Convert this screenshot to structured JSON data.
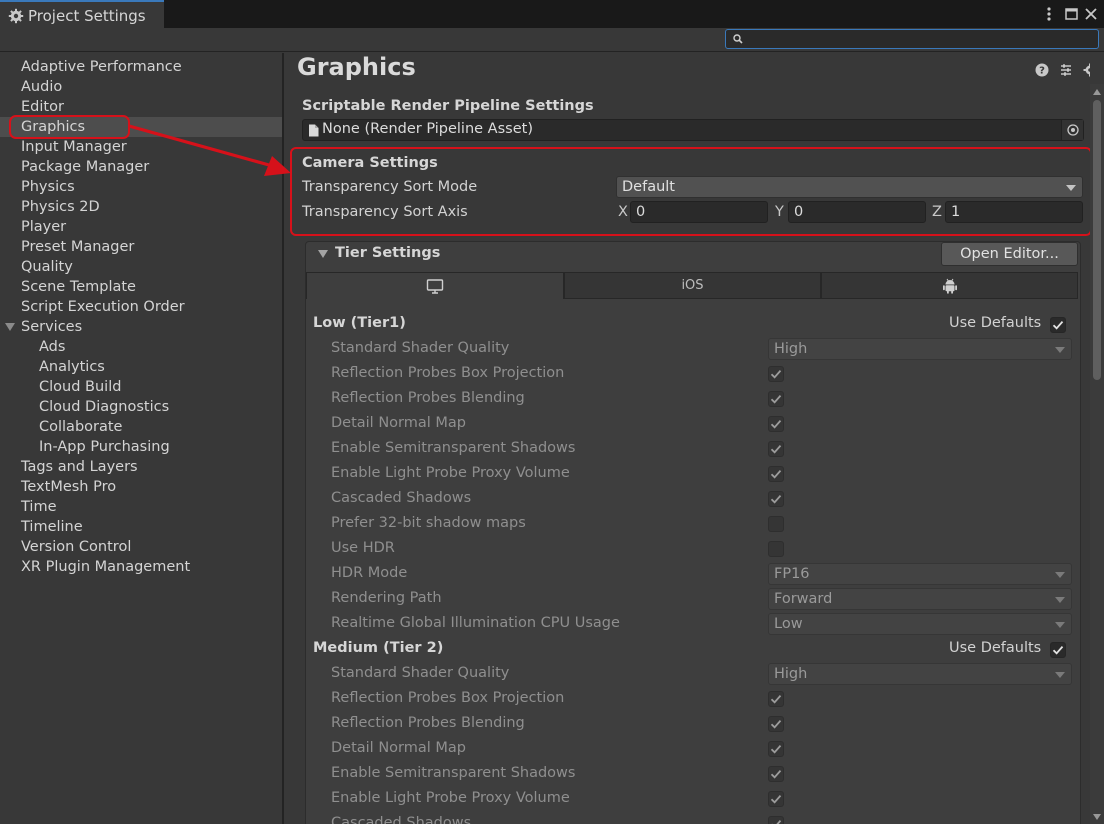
{
  "window": {
    "title": "Project Settings"
  },
  "search": {
    "placeholder": "",
    "value": ""
  },
  "sidebar": {
    "items": [
      {
        "label": "Adaptive Performance",
        "indent": 0
      },
      {
        "label": "Audio",
        "indent": 0
      },
      {
        "label": "Editor",
        "indent": 0
      },
      {
        "label": "Graphics",
        "indent": 0,
        "selected": true
      },
      {
        "label": "Input Manager",
        "indent": 0
      },
      {
        "label": "Package Manager",
        "indent": 0
      },
      {
        "label": "Physics",
        "indent": 0
      },
      {
        "label": "Physics 2D",
        "indent": 0
      },
      {
        "label": "Player",
        "indent": 0
      },
      {
        "label": "Preset Manager",
        "indent": 0
      },
      {
        "label": "Quality",
        "indent": 0
      },
      {
        "label": "Scene Template",
        "indent": 0
      },
      {
        "label": "Script Execution Order",
        "indent": 0
      },
      {
        "label": "Services",
        "indent": 0,
        "expanded": true
      },
      {
        "label": "Ads",
        "indent": 1
      },
      {
        "label": "Analytics",
        "indent": 1
      },
      {
        "label": "Cloud Build",
        "indent": 1
      },
      {
        "label": "Cloud Diagnostics",
        "indent": 1
      },
      {
        "label": "Collaborate",
        "indent": 1
      },
      {
        "label": "In-App Purchasing",
        "indent": 1
      },
      {
        "label": "Tags and Layers",
        "indent": 0
      },
      {
        "label": "TextMesh Pro",
        "indent": 0
      },
      {
        "label": "Time",
        "indent": 0
      },
      {
        "label": "Timeline",
        "indent": 0
      },
      {
        "label": "Version Control",
        "indent": 0
      },
      {
        "label": "XR Plugin Management",
        "indent": 0
      }
    ]
  },
  "main": {
    "title": "Graphics",
    "srp": {
      "heading": "Scriptable Render Pipeline Settings",
      "value": "None (Render Pipeline Asset)"
    },
    "camera": {
      "heading": "Camera Settings",
      "sort_mode_label": "Transparency Sort Mode",
      "sort_mode_value": "Default",
      "sort_axis_label": "Transparency Sort Axis",
      "axis": {
        "x_label": "X",
        "x": "0",
        "y_label": "Y",
        "y": "0",
        "z_label": "Z",
        "z": "1"
      }
    },
    "tier": {
      "heading": "Tier Settings",
      "open_editor": "Open Editor...",
      "tabs": [
        {
          "label": "",
          "icon": "monitor-icon"
        },
        {
          "label": "iOS"
        },
        {
          "label": "",
          "icon": "android-icon"
        }
      ],
      "use_defaults_label": "Use Defaults",
      "tiers": [
        {
          "title": "Low (Tier1)",
          "use_defaults": true,
          "rows": [
            {
              "label": "Standard Shader Quality",
              "type": "dropdown",
              "value": "High"
            },
            {
              "label": "Reflection Probes Box Projection",
              "type": "check",
              "checked": true
            },
            {
              "label": "Reflection Probes Blending",
              "type": "check",
              "checked": true
            },
            {
              "label": "Detail Normal Map",
              "type": "check",
              "checked": true
            },
            {
              "label": "Enable Semitransparent Shadows",
              "type": "check",
              "checked": true
            },
            {
              "label": "Enable Light Probe Proxy Volume",
              "type": "check",
              "checked": true
            },
            {
              "label": "Cascaded Shadows",
              "type": "check",
              "checked": true
            },
            {
              "label": "Prefer 32-bit shadow maps",
              "type": "check",
              "checked": false
            },
            {
              "label": "Use HDR",
              "type": "check",
              "checked": false
            },
            {
              "label": "HDR Mode",
              "type": "dropdown",
              "value": "FP16"
            },
            {
              "label": "Rendering Path",
              "type": "dropdown",
              "value": "Forward"
            },
            {
              "label": "Realtime Global Illumination CPU Usage",
              "type": "dropdown",
              "value": "Low"
            }
          ]
        },
        {
          "title": "Medium (Tier 2)",
          "use_defaults": true,
          "rows": [
            {
              "label": "Standard Shader Quality",
              "type": "dropdown",
              "value": "High"
            },
            {
              "label": "Reflection Probes Box Projection",
              "type": "check",
              "checked": true
            },
            {
              "label": "Reflection Probes Blending",
              "type": "check",
              "checked": true
            },
            {
              "label": "Detail Normal Map",
              "type": "check",
              "checked": true
            },
            {
              "label": "Enable Semitransparent Shadows",
              "type": "check",
              "checked": true
            },
            {
              "label": "Enable Light Probe Proxy Volume",
              "type": "check",
              "checked": true
            },
            {
              "label": "Cascaded Shadows",
              "type": "check",
              "checked": true
            }
          ]
        }
      ]
    }
  },
  "colors": {
    "annotation_red": "#d6111a",
    "accent_blue": "#3a79bb"
  }
}
